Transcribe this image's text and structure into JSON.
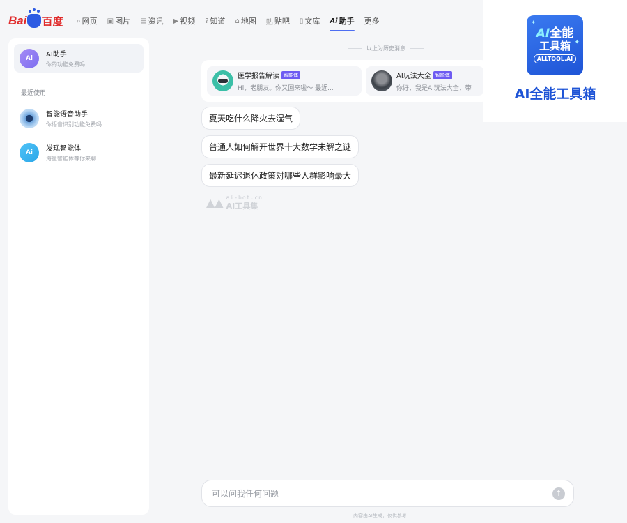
{
  "header": {
    "logo": {
      "bai": "Bai",
      "baidu_cn": "百度"
    },
    "nav": [
      {
        "icon": "search-icon",
        "glyph": "⌕",
        "label": "网页"
      },
      {
        "icon": "image-icon",
        "glyph": "▣",
        "label": "图片"
      },
      {
        "icon": "news-icon",
        "glyph": "▤",
        "label": "资讯"
      },
      {
        "icon": "video-icon",
        "glyph": "▶",
        "label": "视频"
      },
      {
        "icon": "question-icon",
        "glyph": "?",
        "label": "知道"
      },
      {
        "icon": "map-icon",
        "glyph": "⌂",
        "label": "地图"
      },
      {
        "icon": "tieba-icon",
        "glyph": "贴",
        "label": "贴吧"
      },
      {
        "icon": "doc-icon",
        "glyph": "▯",
        "label": "文库"
      },
      {
        "icon": "ai-icon",
        "glyph": "Ai",
        "label": "助手"
      },
      {
        "icon": "",
        "glyph": "",
        "label": "更多"
      }
    ]
  },
  "sidebar": {
    "assistant": {
      "icon_text": "Ai",
      "title": "AI助手",
      "subtitle": "你的功能免费吗"
    },
    "section_label": "最近使用",
    "items": [
      {
        "title": "智能语音助手",
        "subtitle": "你语音识别功能免费吗"
      },
      {
        "icon_text": "Ai",
        "title": "发现智能体",
        "subtitle": "海量智能体等你来聊"
      }
    ]
  },
  "main": {
    "history_divider": "以上为历史消息",
    "agents": [
      {
        "name": "医学报告解读",
        "badge": "智能体",
        "desc": "Hi，老朋友。你又回来啦～ 最近..."
      },
      {
        "name": "AI玩法大全",
        "badge": "智能体",
        "desc": "你好，我是AI玩法大全，带"
      }
    ],
    "suggestions": [
      "夏天吃什么降火去湿气",
      "普通人如何解开世界十大数学未解之谜",
      "最新延迟退休政策对哪些人群影响最大"
    ],
    "watermark": {
      "small": "ai-bot.cn",
      "big": "AI工具集"
    },
    "input": {
      "placeholder": "可以问我任何问题",
      "value": ""
    },
    "send_glyph": "↑",
    "footer_note": "内容由AI生成，仅供参考"
  },
  "brand": {
    "logo_line1_ai": "AI",
    "logo_line1_rest": "全能",
    "logo_line2": "工具箱",
    "logo_line3": "ALLTOOL.AI",
    "title": "AI全能工具箱"
  },
  "colors": {
    "accent": "#4e6ef2",
    "badge": "#6e5bf2",
    "brand_blue": "#1e54d6",
    "baidu_red": "#e02a2a"
  }
}
